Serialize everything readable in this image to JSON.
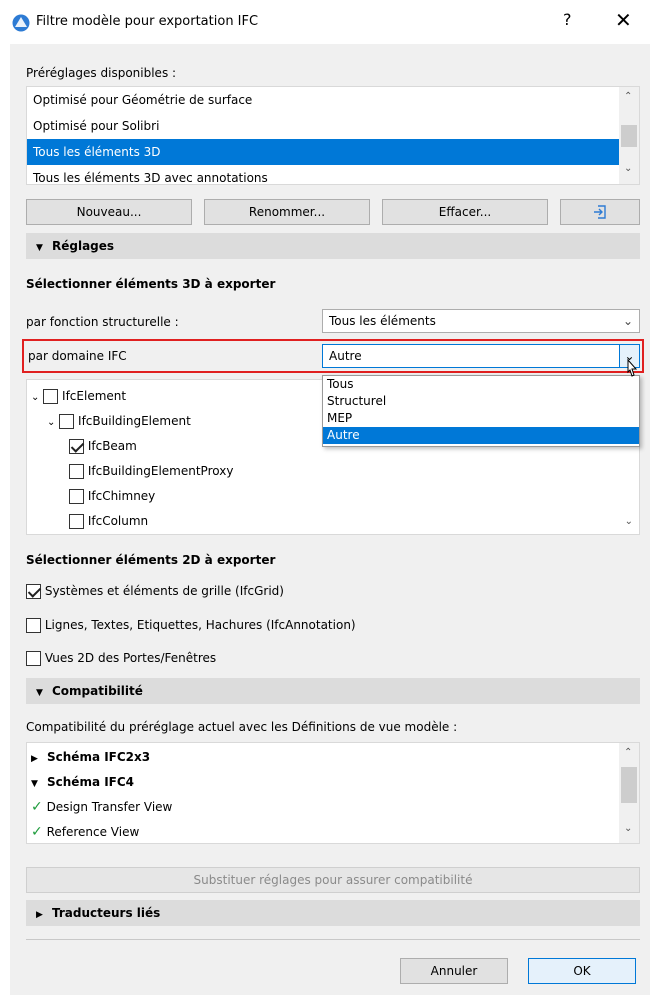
{
  "window": {
    "title": "Filtre modèle pour exportation IFC",
    "help": "?",
    "close": "✕"
  },
  "presets": {
    "label": "Préréglages disponibles :",
    "items": [
      {
        "label": "Optimisé pour Géométrie de surface",
        "selected": false
      },
      {
        "label": "Optimisé pour Solibri",
        "selected": false
      },
      {
        "label": "Tous les éléments 3D",
        "selected": true
      },
      {
        "label": "Tous les éléments 3D avec annotations",
        "selected": false
      }
    ],
    "buttons": {
      "new": "Nouveau...",
      "rename": "Renommer...",
      "delete": "Effacer..."
    }
  },
  "settings": {
    "header": "Réglages",
    "select3d_title": "Sélectionner éléments 3D à exporter",
    "structural_label": "par fonction structurelle :",
    "structural_value": "Tous les éléments",
    "domain_label": "par domaine IFC",
    "domain_value": "Autre",
    "domain_options": [
      "Tous",
      "Structurel",
      "MEP",
      "Autre"
    ],
    "tree": [
      {
        "label": "IfcElement",
        "checked": false
      },
      {
        "label": "IfcBuildingElement",
        "checked": false
      },
      {
        "label": "IfcBeam",
        "checked": true
      },
      {
        "label": "IfcBuildingElementProxy",
        "checked": false
      },
      {
        "label": "IfcChimney",
        "checked": false
      },
      {
        "label": "IfcColumn",
        "checked": false
      }
    ],
    "select2d_title": "Sélectionner éléments 2D à exporter",
    "options2d": [
      {
        "label": "Systèmes et éléments de grille (IfcGrid)",
        "checked": true
      },
      {
        "label": "Lignes, Textes, Etiquettes, Hachures (IfcAnnotation)",
        "checked": false
      },
      {
        "label": "Vues 2D des Portes/Fenêtres",
        "checked": false
      }
    ]
  },
  "compat": {
    "header": "Compatibilité",
    "description": "Compatibilité du préréglage actuel avec les Définitions de vue modèle :",
    "items": [
      {
        "label": "Schéma IFC2x3",
        "bold": true
      },
      {
        "label": "Schéma IFC4",
        "bold": true
      },
      {
        "label": "Design Transfer View",
        "bold": false
      },
      {
        "label": "Reference View",
        "bold": false
      }
    ],
    "substitute_button": "Substituer réglages pour assurer compatibilité"
  },
  "translators": {
    "header": "Traducteurs liés"
  },
  "footer": {
    "cancel": "Annuler",
    "ok": "OK"
  },
  "colors": {
    "accent": "#0078d7",
    "highlight_box": "#e02020",
    "check_green": "#1e9c3c"
  }
}
